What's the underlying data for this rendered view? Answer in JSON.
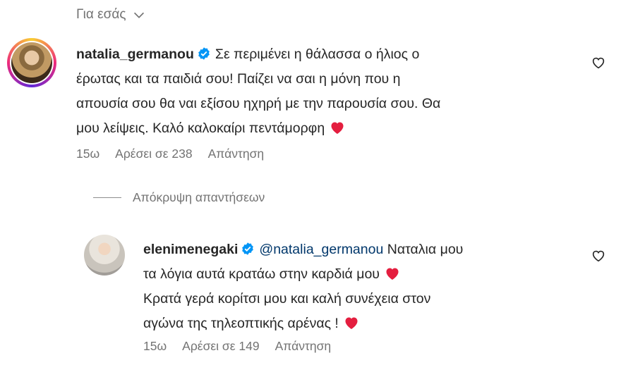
{
  "header": {
    "for_you_label": "Για εσάς"
  },
  "comments": [
    {
      "username": "natalia_germanou",
      "lines": [
        "Σε περιμένει η θάλασσα ο ήλιος ο",
        "έρωτας και τα παιδιά σου! Παίζει να σαι η μόνη που η",
        "απουσία σου θα ναι εξίσου ηχηρή με την παρουσία σου. Θα",
        "μου λείψεις. Καλό καλοκαίρι πεντάμορφη"
      ],
      "time": "15ω",
      "likes": "Αρέσει σε 238",
      "reply": "Απάντηση"
    }
  ],
  "replies_toggle": "Απόκρυψη απαντήσεων",
  "reply_comment": {
    "username": "elenimenegaki",
    "mention": "@natalia_germanou",
    "lines": [
      "Ναταλια μου",
      "τα λόγια αυτά κρατάω στην καρδιά μου",
      "Κρατά γερά κορίτσι μου και καλή συνέχεια στον",
      "αγώνα της τηλεοπτικής αρένας !"
    ],
    "time": "15ω",
    "likes": "Αρέσει σε 149",
    "reply": "Απάντηση"
  },
  "icons": {
    "like": "heart-outline-icon",
    "verified": "verified-badge-icon",
    "emoji": "red-heart-emoji",
    "chevron": "chevron-down-icon"
  },
  "colors": {
    "verified": "#0095f6",
    "heart": "#e41e3f",
    "muted": "#737373"
  }
}
